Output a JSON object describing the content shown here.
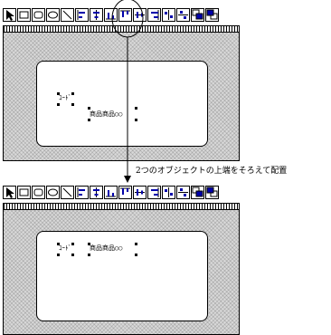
{
  "caption": "2つのオブジェクトの上端をそろえて配置",
  "toolbar": {
    "buttons": [
      {
        "name": "pointer-tool-icon"
      },
      {
        "name": "rectangle-tool-icon"
      },
      {
        "name": "rounded-rectangle-tool-icon"
      },
      {
        "name": "oval-tool-icon"
      },
      {
        "name": "line-tool-icon"
      },
      {
        "name": "align-left-icon"
      },
      {
        "name": "align-center-horizontal-icon"
      },
      {
        "name": "align-bottom-icon"
      },
      {
        "name": "align-top-icon"
      },
      {
        "name": "align-middle-vertical-icon"
      },
      {
        "name": "align-right-icon"
      },
      {
        "name": "distribute-horizontal-icon"
      },
      {
        "name": "distribute-vertical-icon"
      },
      {
        "name": "bring-to-front-icon"
      },
      {
        "name": "send-to-back-icon"
      }
    ]
  },
  "before": {
    "label_object": "ｺｰﾄﾞ",
    "field_object": "商品商品○○"
  },
  "after": {
    "label_object": "ｺｰﾄﾞ",
    "field_object": "商品商品○○"
  }
}
